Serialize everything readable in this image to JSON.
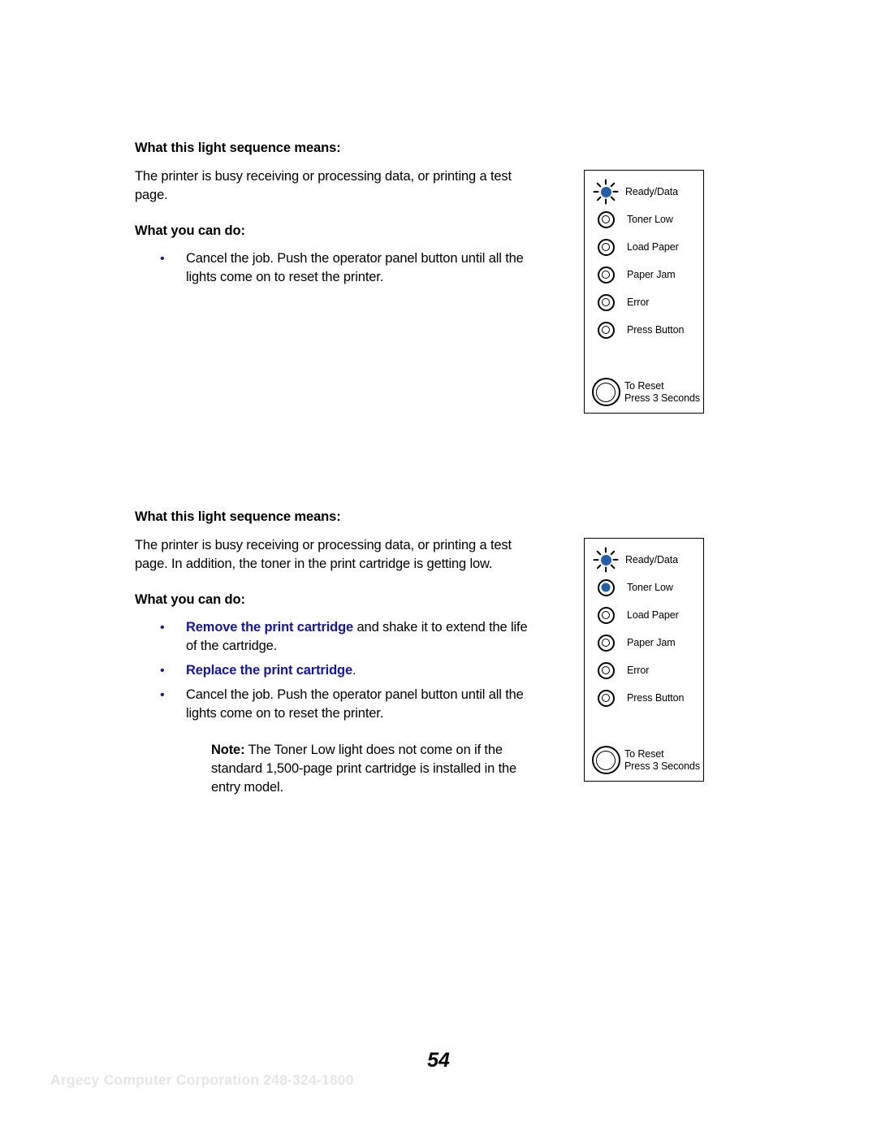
{
  "document": {
    "page_number": "54",
    "watermark": "Argecy Computer Corporation 248-324-1800",
    "colors": {
      "link_blue": "#1414a6",
      "bullet_blue": "#1b1b80",
      "led_blue": "#1f5fae",
      "watermark_gray": "#e6e6e8"
    }
  },
  "sections": [
    {
      "heading_means": "What this light sequence means:",
      "description": "The printer is busy receiving or processing data, or printing a test page.",
      "heading_do": "What you can do:",
      "bullets": [
        {
          "link": "",
          "text": "Cancel the job. Push the operator panel button until all the lights come on to reset the printer."
        }
      ],
      "note": null,
      "panel": {
        "leds": [
          {
            "label": "Ready/Data",
            "state": "blinking"
          },
          {
            "label": "Toner Low",
            "state": "off"
          },
          {
            "label": "Load Paper",
            "state": "off"
          },
          {
            "label": "Paper Jam",
            "state": "off"
          },
          {
            "label": "Error",
            "state": "off"
          },
          {
            "label": "Press Button",
            "state": "off"
          }
        ],
        "reset_line_1": "To Reset",
        "reset_line_2": "Press 3 Seconds"
      }
    },
    {
      "heading_means": "What this light sequence means:",
      "description": "The printer is busy receiving or processing data, or printing a test page. In addition, the toner in the print cartridge is getting low.",
      "heading_do": "What you can do:",
      "bullets": [
        {
          "link": "Remove the print cartridge",
          "text": " and shake it to extend the life of the cartridge."
        },
        {
          "link": "Replace the print cartridge",
          "text": "."
        },
        {
          "link": "",
          "text": "Cancel the job. Push the operator panel button until all the lights come on to reset the printer."
        }
      ],
      "note": {
        "label": "Note:",
        "text": "The Toner Low light does not come on if the standard 1,500-page print cartridge is installed in the entry model."
      },
      "panel": {
        "leds": [
          {
            "label": "Ready/Data",
            "state": "blinking"
          },
          {
            "label": "Toner Low",
            "state": "on"
          },
          {
            "label": "Load Paper",
            "state": "off"
          },
          {
            "label": "Paper Jam",
            "state": "off"
          },
          {
            "label": "Error",
            "state": "off"
          },
          {
            "label": "Press Button",
            "state": "off"
          }
        ],
        "reset_line_1": "To Reset",
        "reset_line_2": "Press 3 Seconds"
      }
    }
  ]
}
